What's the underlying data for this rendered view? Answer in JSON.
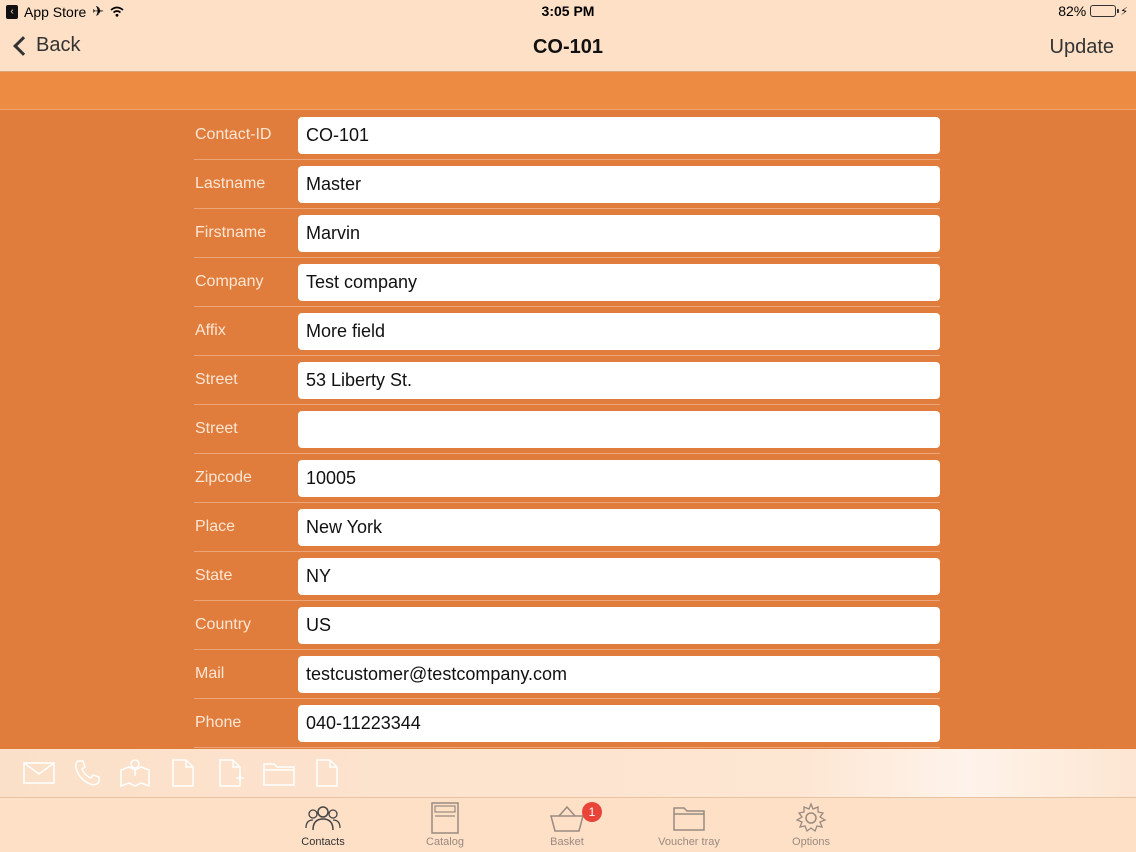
{
  "status_bar": {
    "back_app": "App Store",
    "time": "3:05 PM",
    "battery_percent": "82%",
    "battery_level": 0.82
  },
  "nav": {
    "back_label": "Back",
    "title": "CO-101",
    "update_label": "Update"
  },
  "form": {
    "rows": [
      {
        "label": "Contact-ID",
        "value": "CO-101"
      },
      {
        "label": "Lastname",
        "value": "Master"
      },
      {
        "label": "Firstname",
        "value": "Marvin"
      },
      {
        "label": "Company",
        "value": "Test company"
      },
      {
        "label": "Affix",
        "value": "More field"
      },
      {
        "label": "Street",
        "value": "53 Liberty St."
      },
      {
        "label": "Street",
        "value": ""
      },
      {
        "label": "Zipcode",
        "value": "10005"
      },
      {
        "label": "Place",
        "value": "New York"
      },
      {
        "label": "State",
        "value": "NY"
      },
      {
        "label": "Country",
        "value": "US"
      },
      {
        "label": "Mail",
        "value": "testcustomer@testcompany.com"
      },
      {
        "label": "Phone",
        "value": "040-11223344"
      },
      {
        "label": "",
        "value": ""
      }
    ]
  },
  "action_bar": {
    "icons": [
      "mail-icon",
      "phone-icon",
      "map-icon",
      "document-icon",
      "new-document-icon",
      "folder-icon",
      "document-outline-icon"
    ]
  },
  "tabs": [
    {
      "label": "Contacts",
      "icon": "contacts-icon",
      "active": true
    },
    {
      "label": "Catalog",
      "icon": "catalog-icon",
      "active": false
    },
    {
      "label": "Basket",
      "icon": "basket-icon",
      "active": false,
      "badge": "1"
    },
    {
      "label": "Voucher tray",
      "icon": "folder-icon",
      "active": false
    },
    {
      "label": "Options",
      "icon": "gear-icon",
      "active": false
    }
  ],
  "colors": {
    "background": "#e07d3c",
    "header_band": "#ee8b43",
    "bar": "#fde0c6",
    "badge": "#e8443a"
  }
}
